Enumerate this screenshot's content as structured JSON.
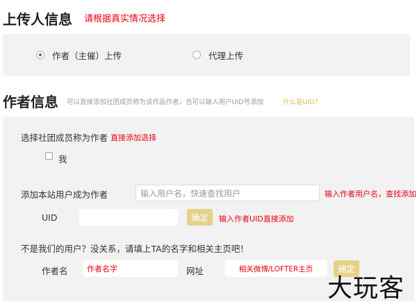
{
  "uploader_section": {
    "title": "上传人信息",
    "hint": "请根据真实情况选择",
    "options": [
      {
        "label": "作者（主催）上传",
        "checked": true
      },
      {
        "label": "代理上传",
        "checked": false
      }
    ]
  },
  "author_section": {
    "title": "作者信息",
    "description": "可以直接添加社团成员称为该作品作者，也可以输入用户UID号添加",
    "uid_link": "什么是UID？",
    "club": {
      "label": "选择社团成员称为作者",
      "add_link": "直接添加选择",
      "me_label": "我"
    },
    "site_user": {
      "label": "添加本站用户成为作者",
      "search_placeholder": "输入用户名，快速查找用户",
      "search_hint": "输入作者用户名，查找添加",
      "uid_label": "UID",
      "uid_value": "",
      "confirm_label": "确定",
      "uid_hint": "输入作者UID直接添加"
    },
    "external": {
      "prompt": "不是我们的用户？没关系，请填上TA的名字和相关主页吧！",
      "name_label": "作者名",
      "name_placeholder": "作者名字",
      "url_label": "网址",
      "url_placeholder": "相关微博/LOFTER主页",
      "confirm_label": "确定"
    }
  },
  "watermark": "大玩客",
  "colors": {
    "accent_red": "#e60012",
    "button_gold": "#e4d289",
    "link_gold": "#d9b84f"
  }
}
